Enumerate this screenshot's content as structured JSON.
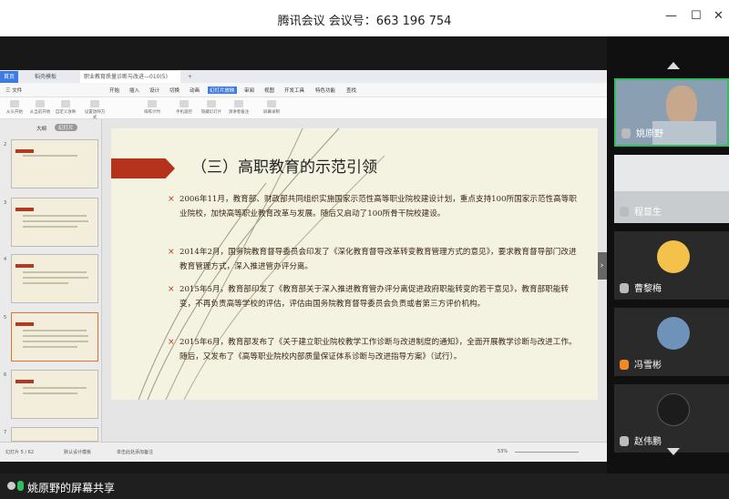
{
  "window": {
    "title": "腾讯会议 会议号：663 196 754"
  },
  "wps": {
    "tabs": [
      "首页",
      "稻壳模板",
      "职业教育质量诊断与改进—010(5)",
      "+"
    ],
    "menus": [
      "三 文件",
      "开始",
      "插入",
      "设计",
      "切换",
      "动画",
      "幻灯片放映",
      "审阅",
      "视图",
      "开发工具",
      "特色功能",
      "查找"
    ],
    "toolbar": [
      "从头开始",
      "从当前开始",
      "自定义放映",
      "设置放映方式",
      "排练计时",
      "手机遥控",
      "隐藏幻灯片",
      "演讲者备注",
      "屏幕录制"
    ],
    "left_tabs": [
      "大纲",
      "幻灯片"
    ],
    "status": {
      "slide": "幻灯片 5 / 62",
      "theme": "默认设计模板",
      "notes": "单击此处添加备注",
      "zoom": "53%"
    }
  },
  "slide": {
    "title": "（三）高职教育的示范引领",
    "bullets": [
      "2006年11月，教育部、财政部共同组织实施国家示范性高等职业院校建设计划，重点支持100所国家示范性高等职业院校，加快高等职业教育改革与发展。随后又启动了100所骨干院校建设。",
      "2014年2月，国务院教育督导委员会印发了《深化教育督导改革转变教育管理方式的意见》，要求教育督导部门改进教育管理方式，深入推进管办评分离。",
      "2015年5月，教育部印发了《教育部关于深入推进教育管办评分离促进政府职能转变的若干意见》，教育部职能转变，不再负责高等学校的评估，评估由国务院教育督导委员会负责或者第三方评价机构。",
      "2015年6月，教育部发布了《关于建立职业院校教学工作诊断与改进制度的通知》，全面开展教学诊断与改进工作。随后，又发布了《高等职业院校内部质量保证体系诊断与改进指导方案》（试行）。"
    ]
  },
  "participants": [
    {
      "name": "姚原野",
      "speaking": true
    },
    {
      "name": "程显生"
    },
    {
      "name": "曹黎梅"
    },
    {
      "name": "冯雪彬"
    },
    {
      "name": "赵伟鹏"
    }
  ],
  "bottom": {
    "share_label": "姚原野的屏幕共享"
  }
}
